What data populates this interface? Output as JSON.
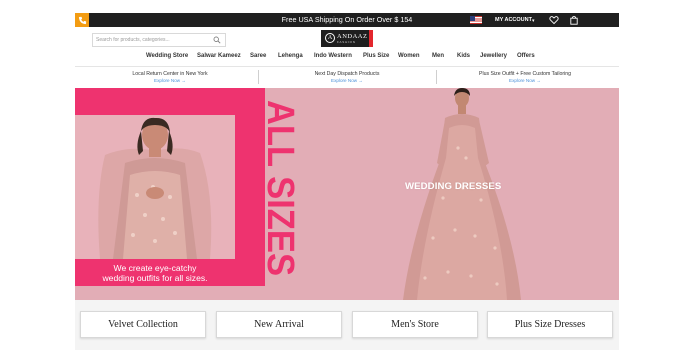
{
  "topbar": {
    "shipping_text": "Free USA Shipping On Order Over $ 154",
    "account_label": "MY ACCOUNT",
    "phone_icon": "phone-icon",
    "flag_icon": "us-flag-icon",
    "wishlist_icon": "heart-icon",
    "cart_icon": "shopping-bag-icon",
    "colors": {
      "bar": "#1f1f1f",
      "phone": "#f39c12"
    }
  },
  "search": {
    "placeholder": "Search for products, categories..."
  },
  "logo": {
    "mark": "A",
    "name": "ANDAAZ",
    "sub": "FASHION"
  },
  "nav": {
    "items": [
      "Wedding Store",
      "Salwar Kameez",
      "Saree",
      "Lehenga",
      "Indo Western",
      "Plus Size",
      "Women",
      "Men",
      "Kids",
      "Jewellery",
      "Offers"
    ]
  },
  "benefits": [
    {
      "title": "Local Return Center in New York",
      "link": "Explore Now →"
    },
    {
      "title": "Next Day Dispatch Products",
      "link": "Explore Now →"
    },
    {
      "title": "Plus Size Outfit + Free Custom Tailoring",
      "link": "Explore Now →"
    }
  ],
  "banner": {
    "vertical_text": "ALL SIZES",
    "caption_line1": "We create eye-catchy",
    "caption_line2": "wedding outfits for all sizes.",
    "right_label": "WEDDING DRESSES",
    "colors": {
      "accent_pink": "#ee336f",
      "background": "#e2adb6"
    }
  },
  "categories": [
    "Velvet Collection",
    "New Arrival",
    "Men's Store",
    "Plus Size Dresses"
  ]
}
